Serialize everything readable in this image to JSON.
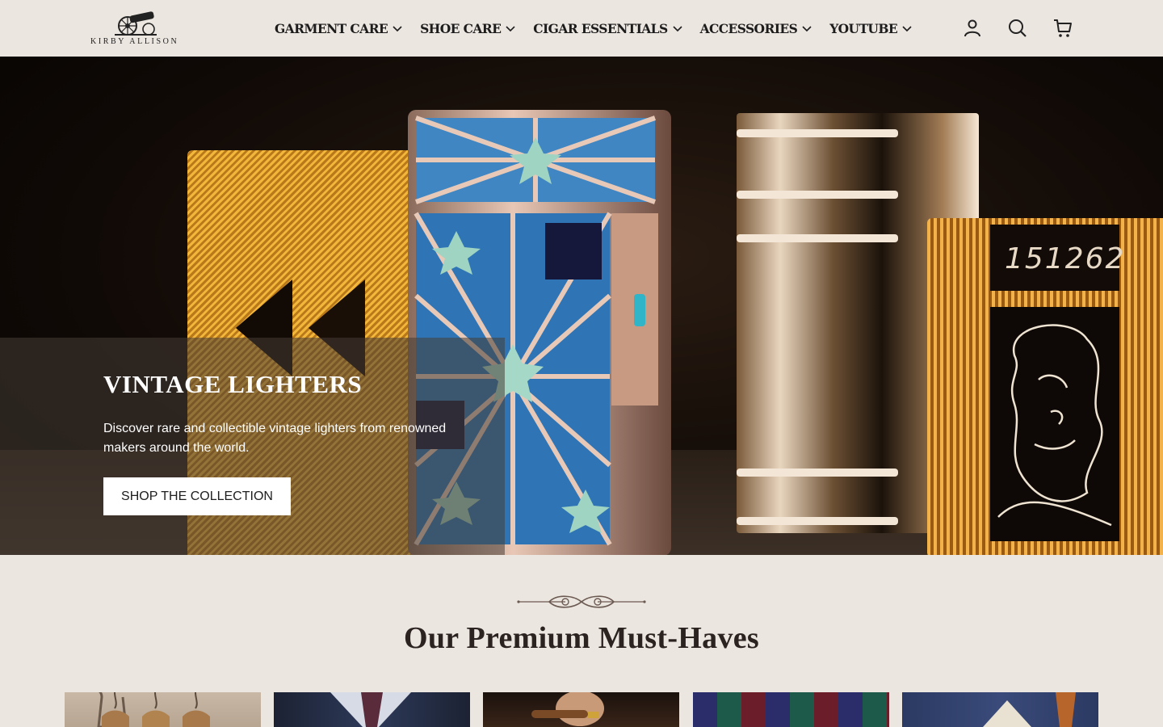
{
  "brand": {
    "logo_text": "KIRBY ALLISON"
  },
  "nav": {
    "items": [
      {
        "label": "GARMENT CARE"
      },
      {
        "label": "SHOE CARE"
      },
      {
        "label": "CIGAR ESSENTIALS"
      },
      {
        "label": "ACCESSORIES"
      },
      {
        "label": "YOUTUBE"
      }
    ]
  },
  "header_icons": [
    "account-icon",
    "search-icon",
    "cart-icon"
  ],
  "hero": {
    "title": "VINTAGE LIGHTERS",
    "description": "Discover rare and collectible vintage lighters from renowned makers around the world.",
    "button_label": "SHOP THE COLLECTION",
    "image_text": "151262"
  },
  "section": {
    "title": "Our Premium Must-Haves",
    "cards": [
      "hangers",
      "suit-and-tie",
      "cigar",
      "ties",
      "pocket-square"
    ]
  },
  "colors": {
    "background": "#ece6e0",
    "text": "#1f1f1f",
    "button_bg": "#ffffff"
  }
}
